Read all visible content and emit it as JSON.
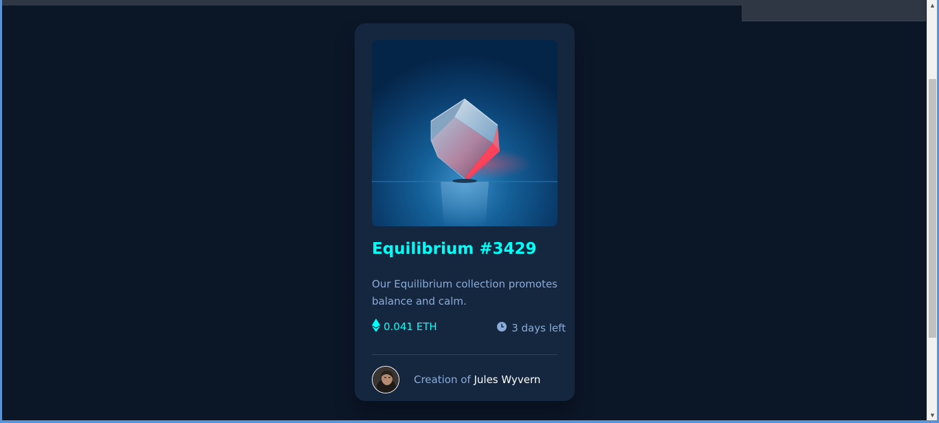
{
  "card": {
    "image_alt": "Equilibrium crystal cube",
    "title": "Equilibrium #3429",
    "description": "Our Equilibrium collection promotes balance and calm.",
    "price": "0.041 ETH",
    "time_left": "3 days left",
    "creator_prefix": "Creation of",
    "creator_name": "Jules Wyvern"
  },
  "icons": {
    "price": "ethereum-icon",
    "time": "clock-icon",
    "avatar": "avatar"
  },
  "colors": {
    "page_background": "#0b1627",
    "card_background": "#15263f",
    "accent_cyan": "#00fff8",
    "soft_blue": "#8bacd9",
    "white": "#ffffff",
    "divider": "#2e405a"
  }
}
